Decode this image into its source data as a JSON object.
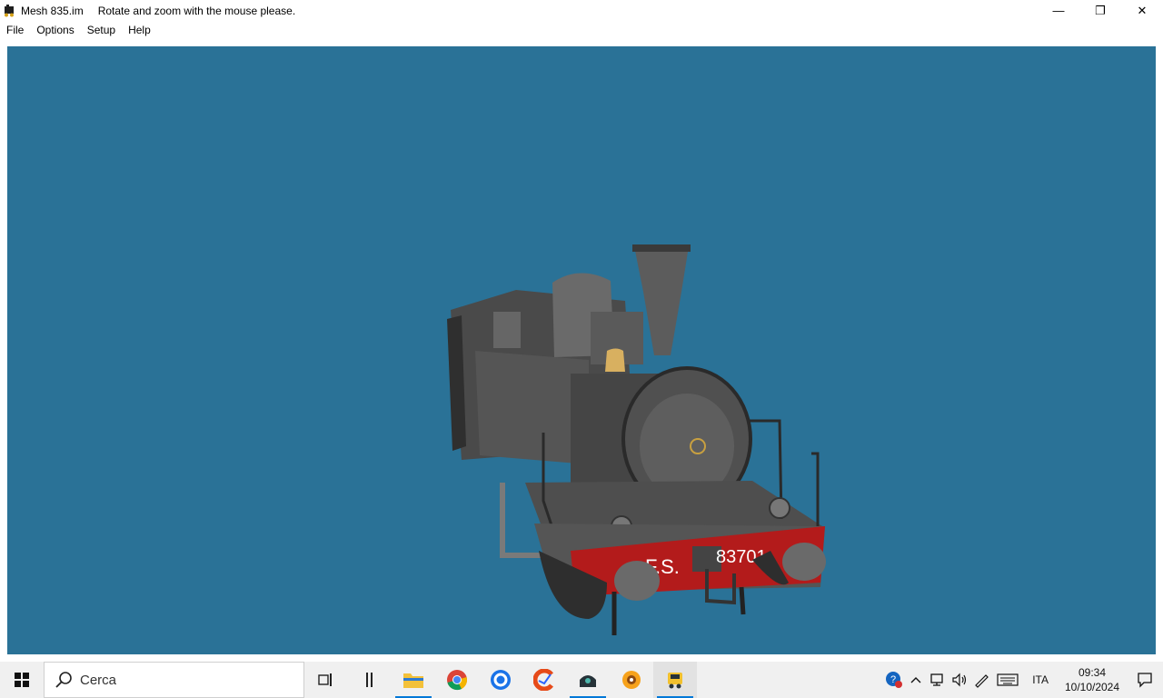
{
  "window": {
    "title_file": "Mesh 835.im",
    "title_message": "Rotate and zoom with the mouse please.",
    "controls": {
      "minimize": "—",
      "restore": "❐",
      "close": "✕"
    }
  },
  "menu": {
    "items": [
      {
        "label": "File"
      },
      {
        "label": "Options"
      },
      {
        "label": "Setup"
      },
      {
        "label": "Help"
      }
    ]
  },
  "viewport": {
    "background_color": "#2a7297",
    "model": {
      "plate_letters": "F.S.",
      "plate_number": "83701"
    }
  },
  "taskbar": {
    "search_placeholder": "Cerca",
    "apps": [
      {
        "icon": "task-view-icon"
      },
      {
        "icon": "widgets-icon"
      },
      {
        "icon": "file-explorer-icon"
      },
      {
        "icon": "chrome-icon"
      },
      {
        "icon": "blue-circle-app-icon"
      },
      {
        "icon": "ccleaner-icon"
      },
      {
        "icon": "steam-locomotive-app-icon"
      },
      {
        "icon": "orange-wheel-app-icon"
      },
      {
        "icon": "mesh-viewer-icon"
      }
    ],
    "tray": {
      "language": "ITA",
      "time": "09:34",
      "date": "10/10/2024"
    }
  }
}
